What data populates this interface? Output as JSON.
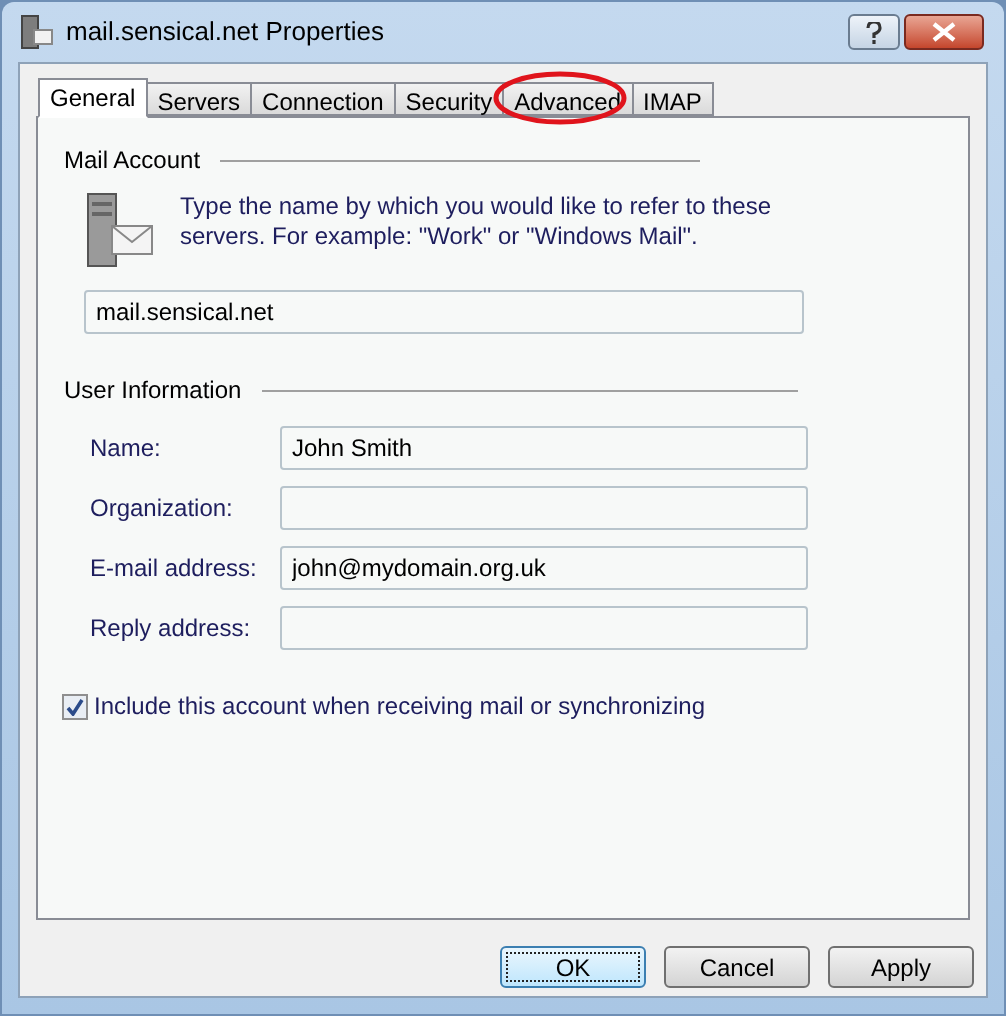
{
  "window": {
    "title": "mail.sensical.net Properties"
  },
  "tabs": [
    {
      "label": "General",
      "selected": true,
      "highlighted": false
    },
    {
      "label": "Servers",
      "selected": false,
      "highlighted": false
    },
    {
      "label": "Connection",
      "selected": false,
      "highlighted": false
    },
    {
      "label": "Security",
      "selected": false,
      "highlighted": false
    },
    {
      "label": "Advanced",
      "selected": false,
      "highlighted": true
    },
    {
      "label": "IMAP",
      "selected": false,
      "highlighted": false
    }
  ],
  "mail_account": {
    "heading": "Mail Account",
    "description": "Type the name by which you would like to refer to these servers.  For example: \"Work\" or \"Windows Mail\".",
    "value": "mail.sensical.net"
  },
  "user_information": {
    "heading": "User Information",
    "fields": [
      {
        "label": "Name:",
        "value": "John Smith"
      },
      {
        "label": "Organization:"
      },
      {
        "label": "E-mail address:",
        "value": "john@mydomain.org.uk"
      },
      {
        "label": "Reply address:"
      }
    ]
  },
  "include_checkbox": {
    "label": "Include this account when receiving mail or synchronizing",
    "checked": true
  },
  "buttons": [
    {
      "label": "OK",
      "default": true
    },
    {
      "label": "Cancel",
      "default": false
    },
    {
      "label": "Apply",
      "default": false
    }
  ]
}
